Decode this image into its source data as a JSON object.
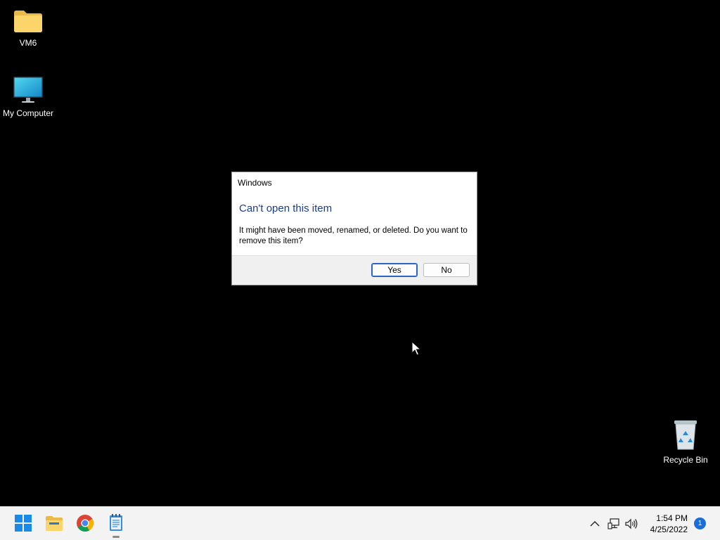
{
  "desktop": {
    "icons": [
      {
        "label": "VM6",
        "icon": "folder-icon"
      },
      {
        "label": "My Computer",
        "icon": "monitor-icon"
      },
      {
        "label": "Recycle Bin",
        "icon": "recycle-bin-icon"
      }
    ]
  },
  "dialog": {
    "title": "Windows",
    "heading": "Can't open this item",
    "message": "It might have been moved, renamed, or deleted. Do you want to remove this item?",
    "yes_label": "Yes",
    "no_label": "No"
  },
  "taskbar": {
    "apps": [
      {
        "icon": "windows-start-icon"
      },
      {
        "icon": "file-explorer-icon"
      },
      {
        "icon": "chrome-icon"
      },
      {
        "icon": "notepad-icon",
        "running": true
      }
    ],
    "tray": {
      "time": "1:54 PM",
      "date": "4/25/2022",
      "notification_count": "1"
    }
  },
  "colors": {
    "desktop_bg": "#000000",
    "dialog_heading": "#1c3c8c",
    "accent": "#2a66c9",
    "taskbar_bg": "#f3f3f3"
  }
}
